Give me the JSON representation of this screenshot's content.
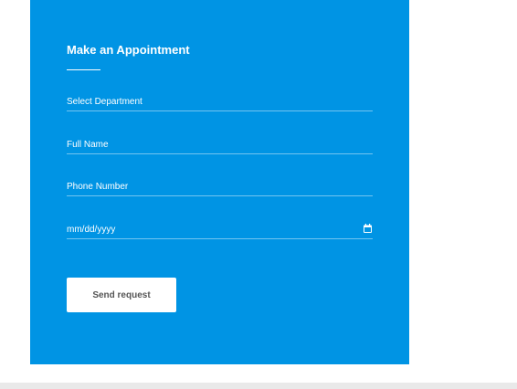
{
  "colors": {
    "panel_background": "#0094e4",
    "text": "#ffffff",
    "button_background": "#ffffff",
    "button_text": "#555555"
  },
  "form": {
    "title": "Make an Appointment",
    "fields": [
      {
        "label": "Select Department",
        "type": "select"
      },
      {
        "label": "Full Name",
        "type": "text"
      },
      {
        "label": "Phone Number",
        "type": "tel"
      },
      {
        "label": "mm/dd/yyyy",
        "type": "date",
        "icon": "calendar-icon"
      }
    ],
    "submit_label": "Send request"
  }
}
